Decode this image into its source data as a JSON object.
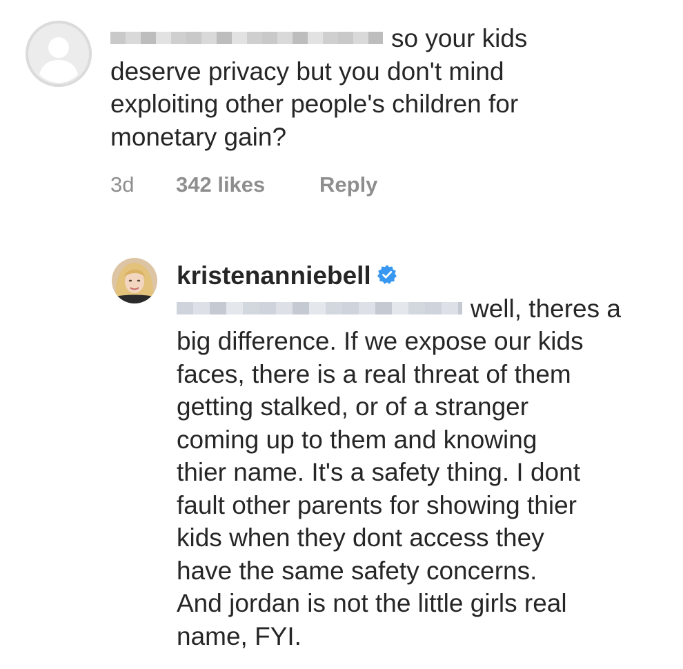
{
  "comment": {
    "avatar_icon": "default-profile-icon",
    "lines": [
      "so your kids",
      "deserve privacy but you don't mind",
      "exploiting other people's children for",
      "monetary gain?"
    ],
    "time": "3d",
    "likes": "342 likes",
    "reply_label": "Reply"
  },
  "reply": {
    "avatar_icon": "profile-photo",
    "username": "kristenanniebell",
    "verified_icon": "verified-badge-icon",
    "lines": [
      "well, theres a",
      "big difference. If we expose our kids",
      "faces, there is a real threat of them",
      "getting stalked, or of a stranger",
      "coming up to them and knowing",
      "thier name. It's a safety thing. I dont",
      "fault other parents for showing thier",
      "kids when they dont access they",
      "have the same safety concerns.",
      "And jordan is not the little girls real",
      "name, FYI."
    ]
  },
  "colors": {
    "text": "#262626",
    "meta": "#8e8e8e",
    "verified": "#3897f0",
    "avatar_placeholder": "#dbdbdb"
  }
}
